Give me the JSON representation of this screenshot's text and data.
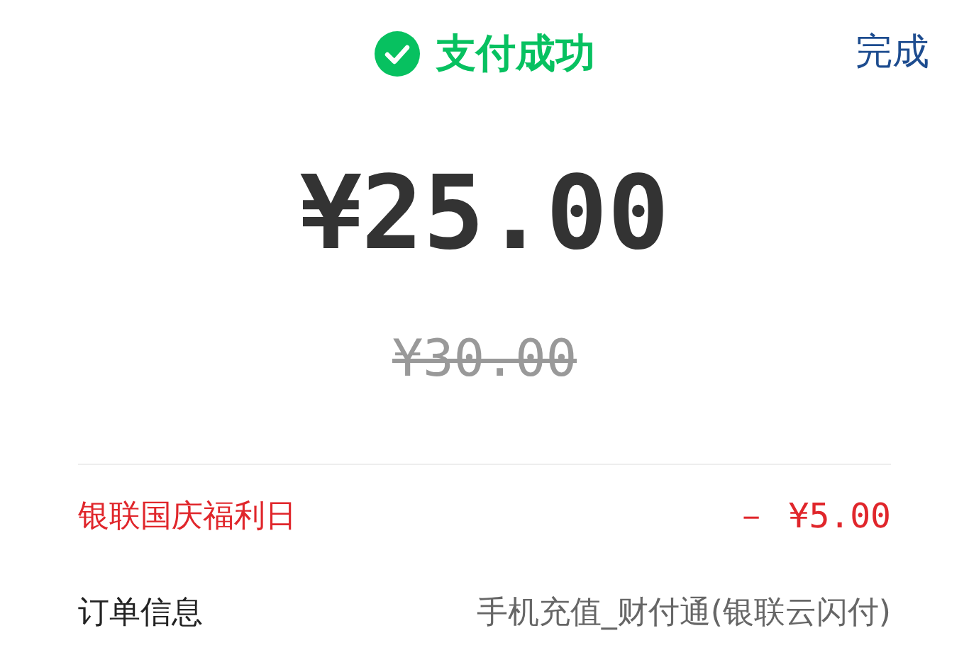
{
  "header": {
    "title": "支付成功",
    "done_button": "完成"
  },
  "amount": "¥25.00",
  "original_price": "¥30.00",
  "rows": [
    {
      "kind": "discount",
      "label": "银联国庆福利日",
      "value": "－ ¥5.00"
    },
    {
      "kind": "info",
      "label": "订单信息",
      "value": "手机充值_财付通(银联云闪付)"
    }
  ]
}
